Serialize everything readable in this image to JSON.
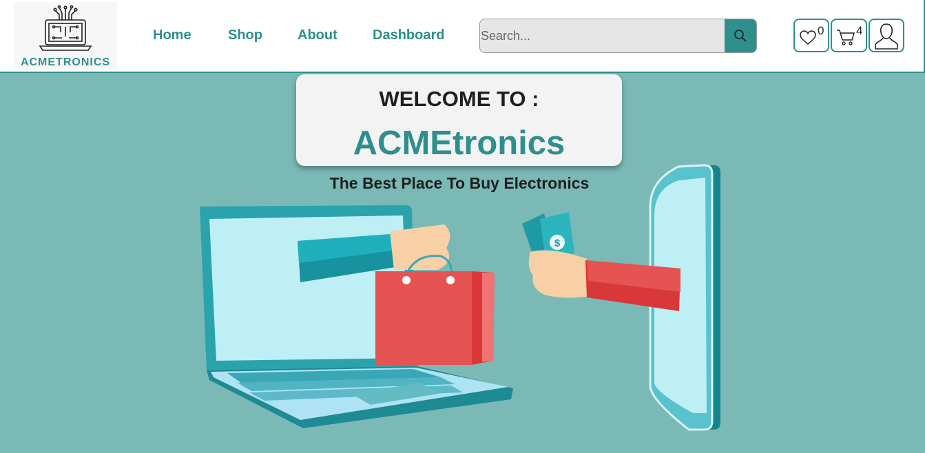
{
  "brand": {
    "logo_text": "ACMETRONICS"
  },
  "nav": {
    "links": [
      {
        "label": "Home"
      },
      {
        "label": "Shop"
      },
      {
        "label": "About"
      },
      {
        "label": "Dashboard"
      }
    ]
  },
  "search": {
    "placeholder": "Search..."
  },
  "actions": {
    "wishlist_count": "0",
    "cart_count": "4"
  },
  "hero": {
    "welcome": "WELCOME TO :",
    "brand_name": "ACMEtronics",
    "tagline": "The Best Place To Buy Electronics"
  },
  "colors": {
    "accent": "#2e8f8c",
    "background": "#7bb9b6",
    "bag": "#e55353",
    "screen": "#bdeff5"
  },
  "icons": [
    "circuit-laptop-icon",
    "search-icon",
    "heart-icon",
    "cart-icon",
    "user-icon"
  ]
}
